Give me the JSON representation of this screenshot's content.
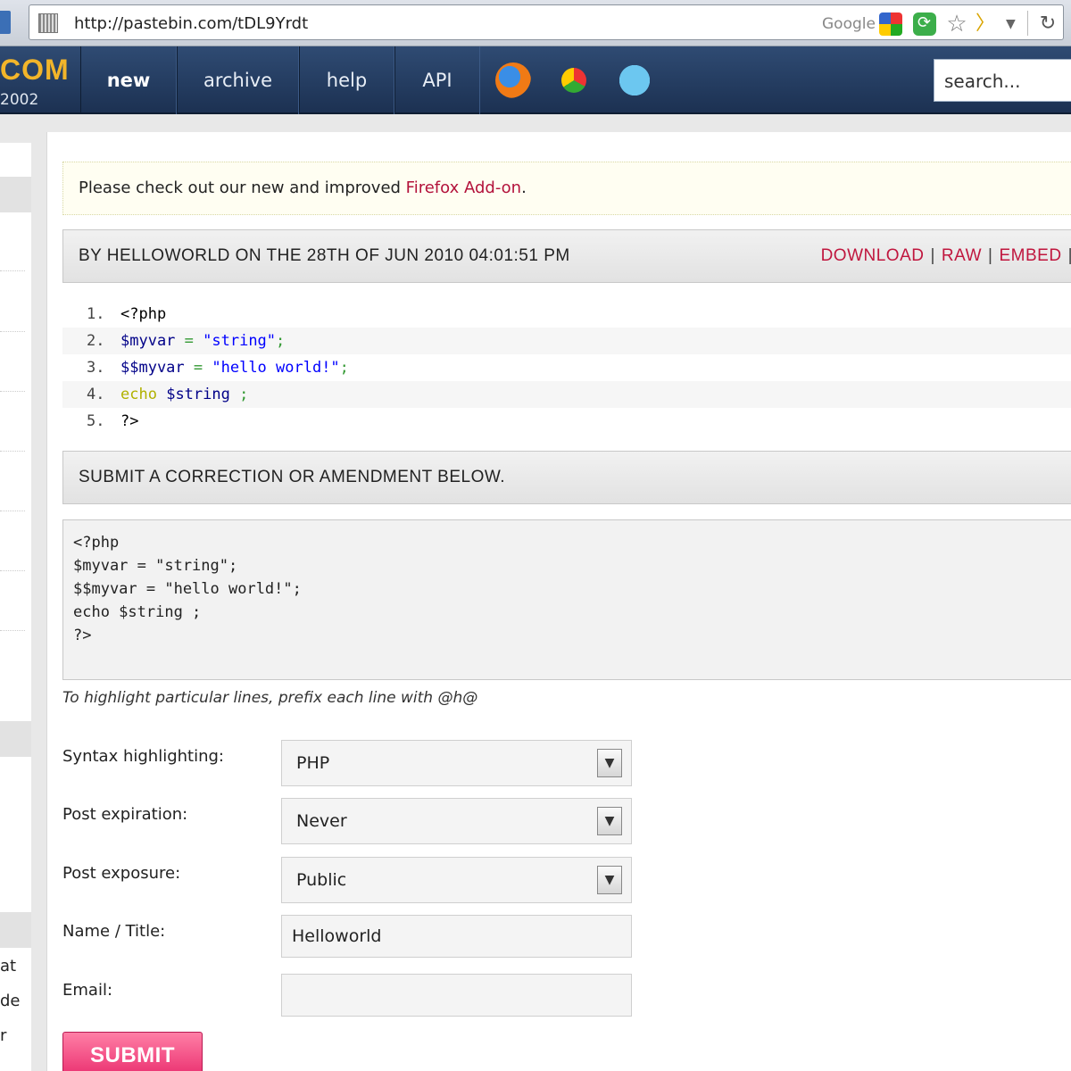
{
  "browser": {
    "url": "http://pastebin.com/tDL9Yrdt",
    "search_engine_label": "Google"
  },
  "header": {
    "logo_text": "COM",
    "logo_sub": "2002",
    "nav": [
      {
        "label": "new",
        "active": true
      },
      {
        "label": "archive"
      },
      {
        "label": "help"
      },
      {
        "label": "API"
      }
    ],
    "icons": [
      "firefox-icon",
      "chrome-icon",
      "twitter-icon"
    ],
    "search_placeholder": "search..."
  },
  "sidebar": {
    "text_lines": [
      "at",
      "de",
      "r"
    ]
  },
  "notice": {
    "text": "Please check out our new and improved ",
    "link": "Firefox Add-on",
    "suffix": "."
  },
  "paste": {
    "meta": "BY HELLOWORLD ON THE 28TH OF JUN 2010 04:01:51 PM",
    "links": {
      "download": "DOWNLOAD",
      "raw": "RAW",
      "embed": "EMBED",
      "sep": "|"
    },
    "lines": [
      {
        "num": "1.",
        "tokens": [
          {
            "t": "<?php",
            "c": "plain"
          }
        ]
      },
      {
        "num": "2.",
        "tokens": [
          {
            "t": "$myvar",
            "c": "var"
          },
          {
            "t": " = ",
            "c": "op"
          },
          {
            "t": "\"string\"",
            "c": "str"
          },
          {
            "t": ";",
            "c": "op"
          }
        ]
      },
      {
        "num": "3.",
        "tokens": [
          {
            "t": "$$myvar",
            "c": "var"
          },
          {
            "t": " = ",
            "c": "op"
          },
          {
            "t": "\"hello world!\"",
            "c": "str"
          },
          {
            "t": ";",
            "c": "op"
          }
        ]
      },
      {
        "num": "4.",
        "tokens": [
          {
            "t": "echo",
            "c": "kw"
          },
          {
            "t": " ",
            "c": "plain"
          },
          {
            "t": "$string",
            "c": "var"
          },
          {
            "t": " ;",
            "c": "op"
          }
        ]
      },
      {
        "num": "5.",
        "tokens": [
          {
            "t": "?>",
            "c": "plain"
          }
        ]
      }
    ]
  },
  "correction": {
    "heading": "SUBMIT A CORRECTION OR AMENDMENT BELOW.",
    "code": "<?php\n$myvar = \"string\";\n$$myvar = \"hello world!\";\necho $string ;\n?>",
    "hint": "To highlight particular lines, prefix each line with @h@"
  },
  "form": {
    "syntax_label": "Syntax highlighting:",
    "syntax_value": "PHP",
    "expiration_label": "Post expiration:",
    "expiration_value": "Never",
    "exposure_label": "Post exposure:",
    "exposure_value": "Public",
    "name_label": "Name / Title:",
    "name_value": "Helloworld",
    "email_label": "Email:",
    "email_value": "",
    "submit_label": "SUBMIT"
  }
}
